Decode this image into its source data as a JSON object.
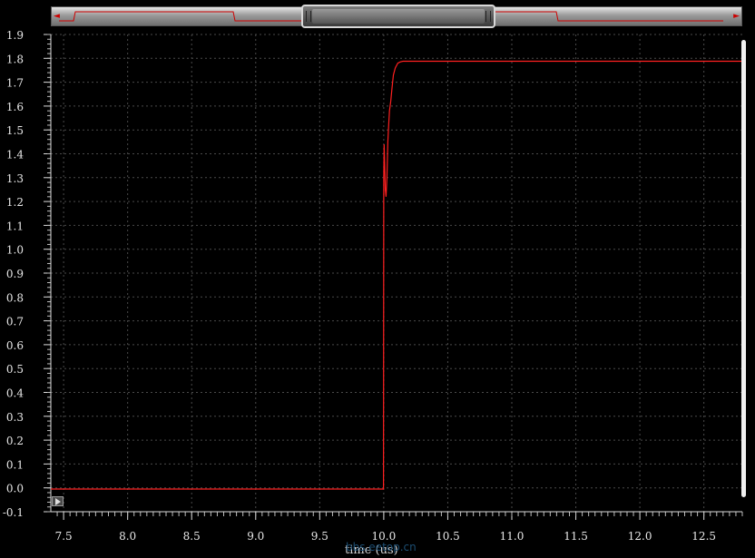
{
  "overview": {
    "left_arrow": "◄",
    "right_arrow": "►"
  },
  "xlabel": "time (us)",
  "watermark": "bbs.eetop.cn",
  "colors": {
    "background": "#000000",
    "trace": "#ff2020",
    "grid": "#555555",
    "axis_text": "#e8e8e8"
  },
  "chart_data": {
    "type": "line",
    "title": "",
    "xlabel": "time (us)",
    "ylabel": "",
    "xlim": [
      7.4,
      12.8
    ],
    "ylim": [
      -0.1,
      1.9
    ],
    "x_ticks": [
      "7.5",
      "8.0",
      "8.5",
      "9.0",
      "9.5",
      "10.0",
      "10.5",
      "11.0",
      "11.5",
      "12.0",
      "12.5"
    ],
    "y_ticks": [
      "-0.1",
      "0.0",
      "0.1",
      "0.2",
      "0.3",
      "0.4",
      "0.5",
      "0.6",
      "0.7",
      "0.8",
      "0.9",
      "1.0",
      "1.1",
      "1.2",
      "1.3",
      "1.4",
      "1.5",
      "1.6",
      "1.7",
      "1.8",
      "1.9"
    ],
    "grid": true,
    "series": [
      {
        "x": [
          7.4,
          9.998,
          10.0,
          10.003,
          10.007,
          10.012,
          10.018,
          10.025,
          10.032,
          10.038,
          10.045,
          10.055,
          10.065,
          10.075,
          10.09,
          10.11,
          10.13,
          10.15,
          10.2,
          10.5,
          11.0,
          12.0,
          12.8
        ],
        "y": [
          -0.005,
          -0.005,
          1.3,
          1.44,
          1.36,
          1.25,
          1.22,
          1.3,
          1.45,
          1.52,
          1.58,
          1.62,
          1.68,
          1.73,
          1.76,
          1.78,
          1.785,
          1.788,
          1.788,
          1.788,
          1.788,
          1.788,
          1.788
        ]
      }
    ]
  }
}
